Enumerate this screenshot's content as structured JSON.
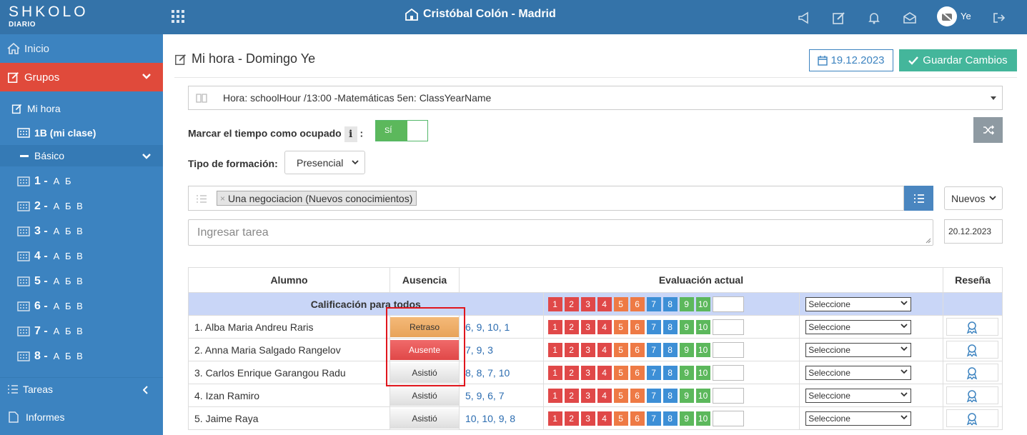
{
  "app": {
    "brand": "SHKOLO",
    "brand_sub": "DIARIO",
    "school": "Cristóbal Colón - Madrid",
    "user": "Ye"
  },
  "sidebar": {
    "inicio": "Inicio",
    "grupos": "Grupos",
    "mi_hora": "Mi hora",
    "mi_clase": "1B (mi clase)",
    "basico": "Básico",
    "groups": [
      {
        "num": "1 -",
        "letters": "А Б"
      },
      {
        "num": "2 -",
        "letters": "А Б В"
      },
      {
        "num": "3 -",
        "letters": "А Б В"
      },
      {
        "num": "4 -",
        "letters": "А Б В"
      },
      {
        "num": "5 -",
        "letters": "А Б В"
      },
      {
        "num": "6 -",
        "letters": "А Б В"
      },
      {
        "num": "7 -",
        "letters": "А Б В"
      },
      {
        "num": "8 -",
        "letters": "А Б В"
      }
    ],
    "tareas": "Tareas",
    "informes": "Informes"
  },
  "main": {
    "title": "Mi hora - Domingo Ye",
    "date_button": "19.12.2023",
    "save_button": "Guardar Cambios",
    "hour_select": "Hora: schoolHour /13:00 -Matemáticas 5en: ClassYearName",
    "busy_label": "Marcar el tiempo como ocupado",
    "busy_colon": ":",
    "toggle_label": "SÍ",
    "training_label": "Tipo de formación:",
    "training_value": "Presencial",
    "tag": "Una negociacion (Nuevos conocimientos)",
    "tag_remove": "×",
    "nuevos": "Nuevos",
    "task_placeholder": "Ingresar tarea",
    "task_date": "20.12.2023"
  },
  "table": {
    "headers": {
      "alumno": "Alumno",
      "ausencia": "Ausencia",
      "evaluacion": "Evaluación actual",
      "resena": "Reseña"
    },
    "all_label": "Calificación para todos",
    "select_placeholder": "Seleccione",
    "grades": [
      "1",
      "2",
      "3",
      "4",
      "5",
      "6",
      "7",
      "8",
      "9",
      "10"
    ],
    "grade_colors": [
      "#e04848",
      "#e04848",
      "#e04848",
      "#e04848",
      "#ee7a45",
      "#ee7a45",
      "#3d8fd6",
      "#3d8fd6",
      "#5cb85c",
      "#5cb85c"
    ],
    "students": [
      {
        "name": "1. Alba Maria Andreu Raris",
        "absence": "Retraso",
        "marks": "6, 9, 10, 1"
      },
      {
        "name": "2. Anna Maria Salgado Rangelov",
        "absence": "Ausente",
        "marks": "7, 9, 3"
      },
      {
        "name": "3. Carlos Enrique Garangou Radu",
        "absence": "Asistió",
        "marks": "8, 8, 7, 10"
      },
      {
        "name": "4. Izan Ramiro",
        "absence": "Asistió",
        "marks": "5, 9, 6, 7"
      },
      {
        "name": "5. Jaime Raya",
        "absence": "Asistió",
        "marks": "10, 10, 9, 8"
      }
    ]
  }
}
